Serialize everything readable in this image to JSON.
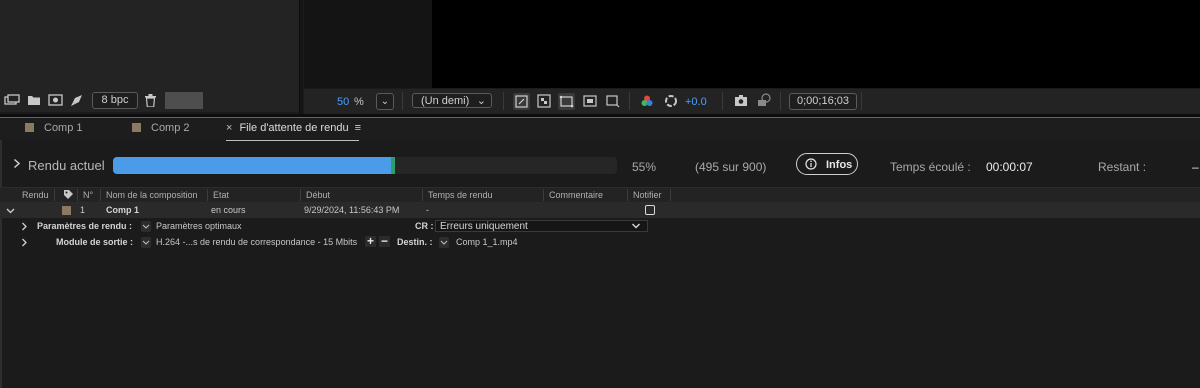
{
  "toolbar_left": {
    "bpc_label": "8 bpc"
  },
  "viewer_toolbar": {
    "zoom_value": "50",
    "zoom_unit": "%",
    "resolution": "(Un demi)",
    "exposure": "+0.0",
    "timecode": "0;00;16;03"
  },
  "tabs": [
    {
      "label": "Comp 1",
      "swatch": "#8b7a62"
    },
    {
      "label": "Comp 2",
      "swatch": "#8b7a62"
    },
    {
      "label": "File d'attente de rendu",
      "close": "×",
      "menu": "≡"
    }
  ],
  "render_status": {
    "label": "Rendu actuel",
    "progress": 0.55,
    "percent": "55%",
    "frames": "(495 sur 900)",
    "infos_button": "Infos",
    "elapsed_label": "Temps écoulé :",
    "elapsed_value": "00:00:07",
    "remaining_label": "Restant :",
    "remaining_value": "–"
  },
  "columns": [
    "Rendu",
    "N°",
    "Nom de la composition",
    "Etat",
    "Début",
    "Temps de rendu",
    "Commentaire",
    "Notifier"
  ],
  "queue_item": {
    "number": "1",
    "name": "Comp 1",
    "status": "en cours",
    "start": "9/29/2024, 11:56:43 PM",
    "render_time": "-",
    "notify_checked": false,
    "swatch": "#8b7a62"
  },
  "render_settings": {
    "label": "Paramètres de rendu :",
    "value": "Paramètres optimaux",
    "log_label": "CR :",
    "log_value": "Erreurs uniquement"
  },
  "output_module": {
    "label": "Module de sortie :",
    "value": "H.264 -...s de rendu de correspondance - 15 Mbits",
    "add": "+",
    "remove": "−",
    "dest_label": "Destin. :",
    "dest_value": "Comp 1_1.mp4"
  },
  "colors": {
    "progress": "#4a9ce8",
    "accent": "#4d9dff"
  }
}
